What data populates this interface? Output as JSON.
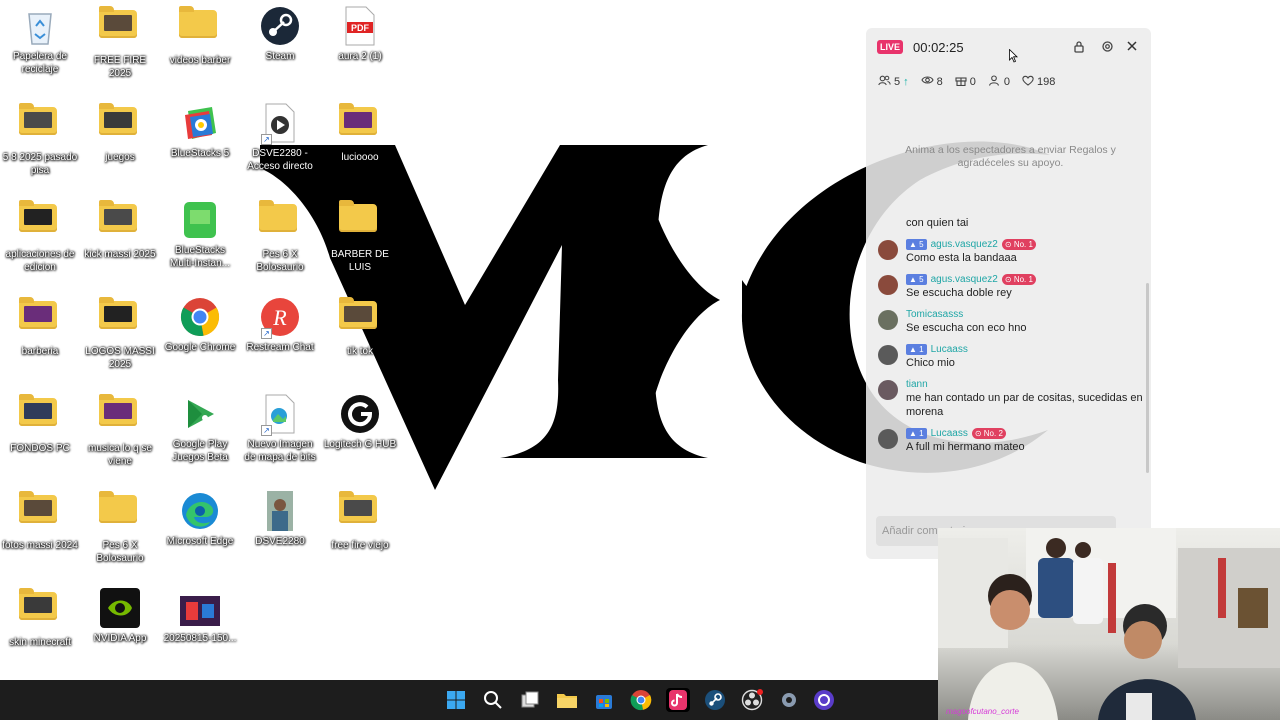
{
  "desktop": {
    "icons": [
      {
        "name": "recycle-bin",
        "label": "Papelera de reciclaje",
        "kind": "recycle"
      },
      {
        "name": "free-fire-2025",
        "label": "FREE FIRE 2025",
        "kind": "folder-thumb"
      },
      {
        "name": "videos-barber",
        "label": "videos barber",
        "kind": "folder"
      },
      {
        "name": "steam",
        "label": "Steam",
        "kind": "steam"
      },
      {
        "name": "aura-2-1",
        "label": "aura 2 (1)",
        "kind": "pdf"
      },
      {
        "name": "5-8-2025-pasado-pisa",
        "label": "5 8 2025 pasado pisa",
        "kind": "folder-thumb"
      },
      {
        "name": "juegos",
        "label": "juegos",
        "kind": "folder-thumb"
      },
      {
        "name": "bluestacks-5",
        "label": "BlueStacks 5",
        "kind": "bluestacks"
      },
      {
        "name": "dsve2280-acceso-directo",
        "label": "DSVE2280 - Acceso directo",
        "kind": "video"
      },
      {
        "name": "lucioooo",
        "label": "lucioooo",
        "kind": "folder-thumb"
      },
      {
        "name": "aplicaciones-de-edicion",
        "label": "aplicaciones de edicion",
        "kind": "folder-thumb"
      },
      {
        "name": "kick-massi-2025",
        "label": "kick massi 2025",
        "kind": "folder-thumb"
      },
      {
        "name": "bluestacks-multi-instance",
        "label": "BlueStacks Multi-Instan...",
        "kind": "bluestacks-multi"
      },
      {
        "name": "pes-6-x-bolosaurio-1",
        "label": "Pes 6 X Bolosaurio",
        "kind": "folder"
      },
      {
        "name": "barber-de-luis",
        "label": "BARBER DE LUIS",
        "kind": "folder"
      },
      {
        "name": "barberia",
        "label": "barberia",
        "kind": "folder-thumb"
      },
      {
        "name": "logos-massi-2025",
        "label": "LOGOS MASSI 2025",
        "kind": "folder-thumb"
      },
      {
        "name": "google-chrome",
        "label": "Google Chrome",
        "kind": "chrome"
      },
      {
        "name": "restream-chat",
        "label": "Restream Chat",
        "kind": "restream"
      },
      {
        "name": "tik-tok",
        "label": "tik tok",
        "kind": "folder-thumb"
      },
      {
        "name": "fondos-pc",
        "label": "FONDOS PC",
        "kind": "folder-thumb"
      },
      {
        "name": "musica-lo-q-se-viene",
        "label": "musica lo q se viene",
        "kind": "folder-thumb"
      },
      {
        "name": "google-play-juegos-beta",
        "label": "Google Play Juegos Beta",
        "kind": "playgames"
      },
      {
        "name": "nuevo-imagen-mapa-bits",
        "label": "Nuevo Imagen de mapa de bits",
        "kind": "bitmap"
      },
      {
        "name": "logitech-g-hub",
        "label": "Logitech G HUB",
        "kind": "ghub"
      },
      {
        "name": "fotos-massi-2024",
        "label": "fotos massi 2024",
        "kind": "folder-thumb"
      },
      {
        "name": "pes-6-x-bolosaurio-2",
        "label": "Pes 6 X Bolosaurio",
        "kind": "folder"
      },
      {
        "name": "microsoft-edge",
        "label": "Microsoft Edge",
        "kind": "edge"
      },
      {
        "name": "dsve2280",
        "label": "DSVE2280",
        "kind": "photo"
      },
      {
        "name": "free-fire-viejo",
        "label": "free fire viejo",
        "kind": "folder-thumb"
      },
      {
        "name": "skin-minecraft",
        "label": "skin minecraft",
        "kind": "folder-thumb"
      },
      {
        "name": "nvidia-app",
        "label": "NVIDIA App",
        "kind": "nvidia"
      },
      {
        "name": "20250815-150",
        "label": "20250815-150...",
        "kind": "image-thumb"
      }
    ]
  },
  "live_panel": {
    "badge": "LIVE",
    "timer": "00:02:25",
    "stats": {
      "viewers_joined": "5",
      "views": "8",
      "gifts": "0",
      "followers": "0",
      "likes": "198"
    },
    "hint": "Anima a los espectadores a enviar Regalos y agradéceles su apoyo.",
    "messages": [
      {
        "user": "",
        "level": "",
        "rank": "",
        "text": "con quien tai"
      },
      {
        "user": "agus.vasquez2",
        "level": "5",
        "rank": "No. 1",
        "text": "Como esta la bandaaa"
      },
      {
        "user": "agus.vasquez2",
        "level": "5",
        "rank": "No. 1",
        "text": "Se escucha doble rey"
      },
      {
        "user": "Tomicasasss",
        "level": "",
        "rank": "",
        "text": "Se escucha con eco hno"
      },
      {
        "user": "Lucaass",
        "level": "1",
        "rank": "",
        "text": "Chico mio"
      },
      {
        "user": "tiann",
        "level": "",
        "rank": "",
        "text": "me han contado un par de cositas, sucedidas en morena"
      },
      {
        "user": "Lucaass",
        "level": "1",
        "rank": "No. 2",
        "text": "A full mi hermano mateo"
      }
    ],
    "comment_placeholder": "Añadir comentario..."
  },
  "webcam": {
    "caption": "magoofcutano_corte"
  },
  "colors": {
    "live": "#e8336b",
    "username": "#1fa6a6",
    "level": "#5b7fe0",
    "rank": "#e04060",
    "taskbar": "#1d1d1d"
  }
}
